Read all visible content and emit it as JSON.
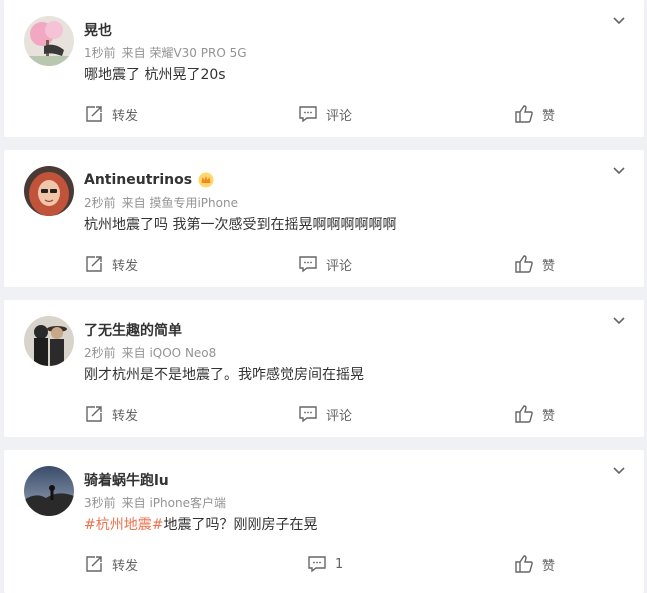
{
  "posts": [
    {
      "name": "晃也",
      "time": "1秒前",
      "source": "来自 荣耀V30 PRO 5G",
      "text_topic": "",
      "text": "哪地震了 杭州晃了20s",
      "repost": "转发",
      "comment": "评论",
      "like": "赞",
      "avatar": "avatar-photo-pink-tree"
    },
    {
      "name": "Antineutrinos",
      "time": "2秒前",
      "source": "来自 摸鱼专用iPhone",
      "text_topic": "",
      "text": "杭州地震了吗 我第一次感受到在摇晃啊啊啊啊啊啊",
      "repost": "转发",
      "comment": "评论",
      "like": "赞",
      "avatar": "avatar-photo-red-hair",
      "vip": "crown-badge-icon"
    },
    {
      "name": "了无生趣的简单",
      "time": "2秒前",
      "source": "来自 iQOO Neo8",
      "text_topic": "",
      "text": "刚才杭州是不是地震了。我咋感觉房间在摇晃",
      "repost": "转发",
      "comment": "评论",
      "like": "赞",
      "avatar": "avatar-photo-two-people"
    },
    {
      "name": "骑着蜗牛跑lu",
      "time": "3秒前",
      "source": "来自 iPhone客户端",
      "text_topic": "#杭州地震#",
      "text": "地震了吗？刚刚房子在晃",
      "repost": "转发",
      "comment": "1",
      "like": "赞",
      "avatar": "avatar-photo-sunset-silhouette"
    }
  ],
  "colors": {
    "background": "#f0f1f4",
    "card": "#ffffff",
    "topic": "#eb7350",
    "meta": "#939393",
    "action": "#636363"
  }
}
